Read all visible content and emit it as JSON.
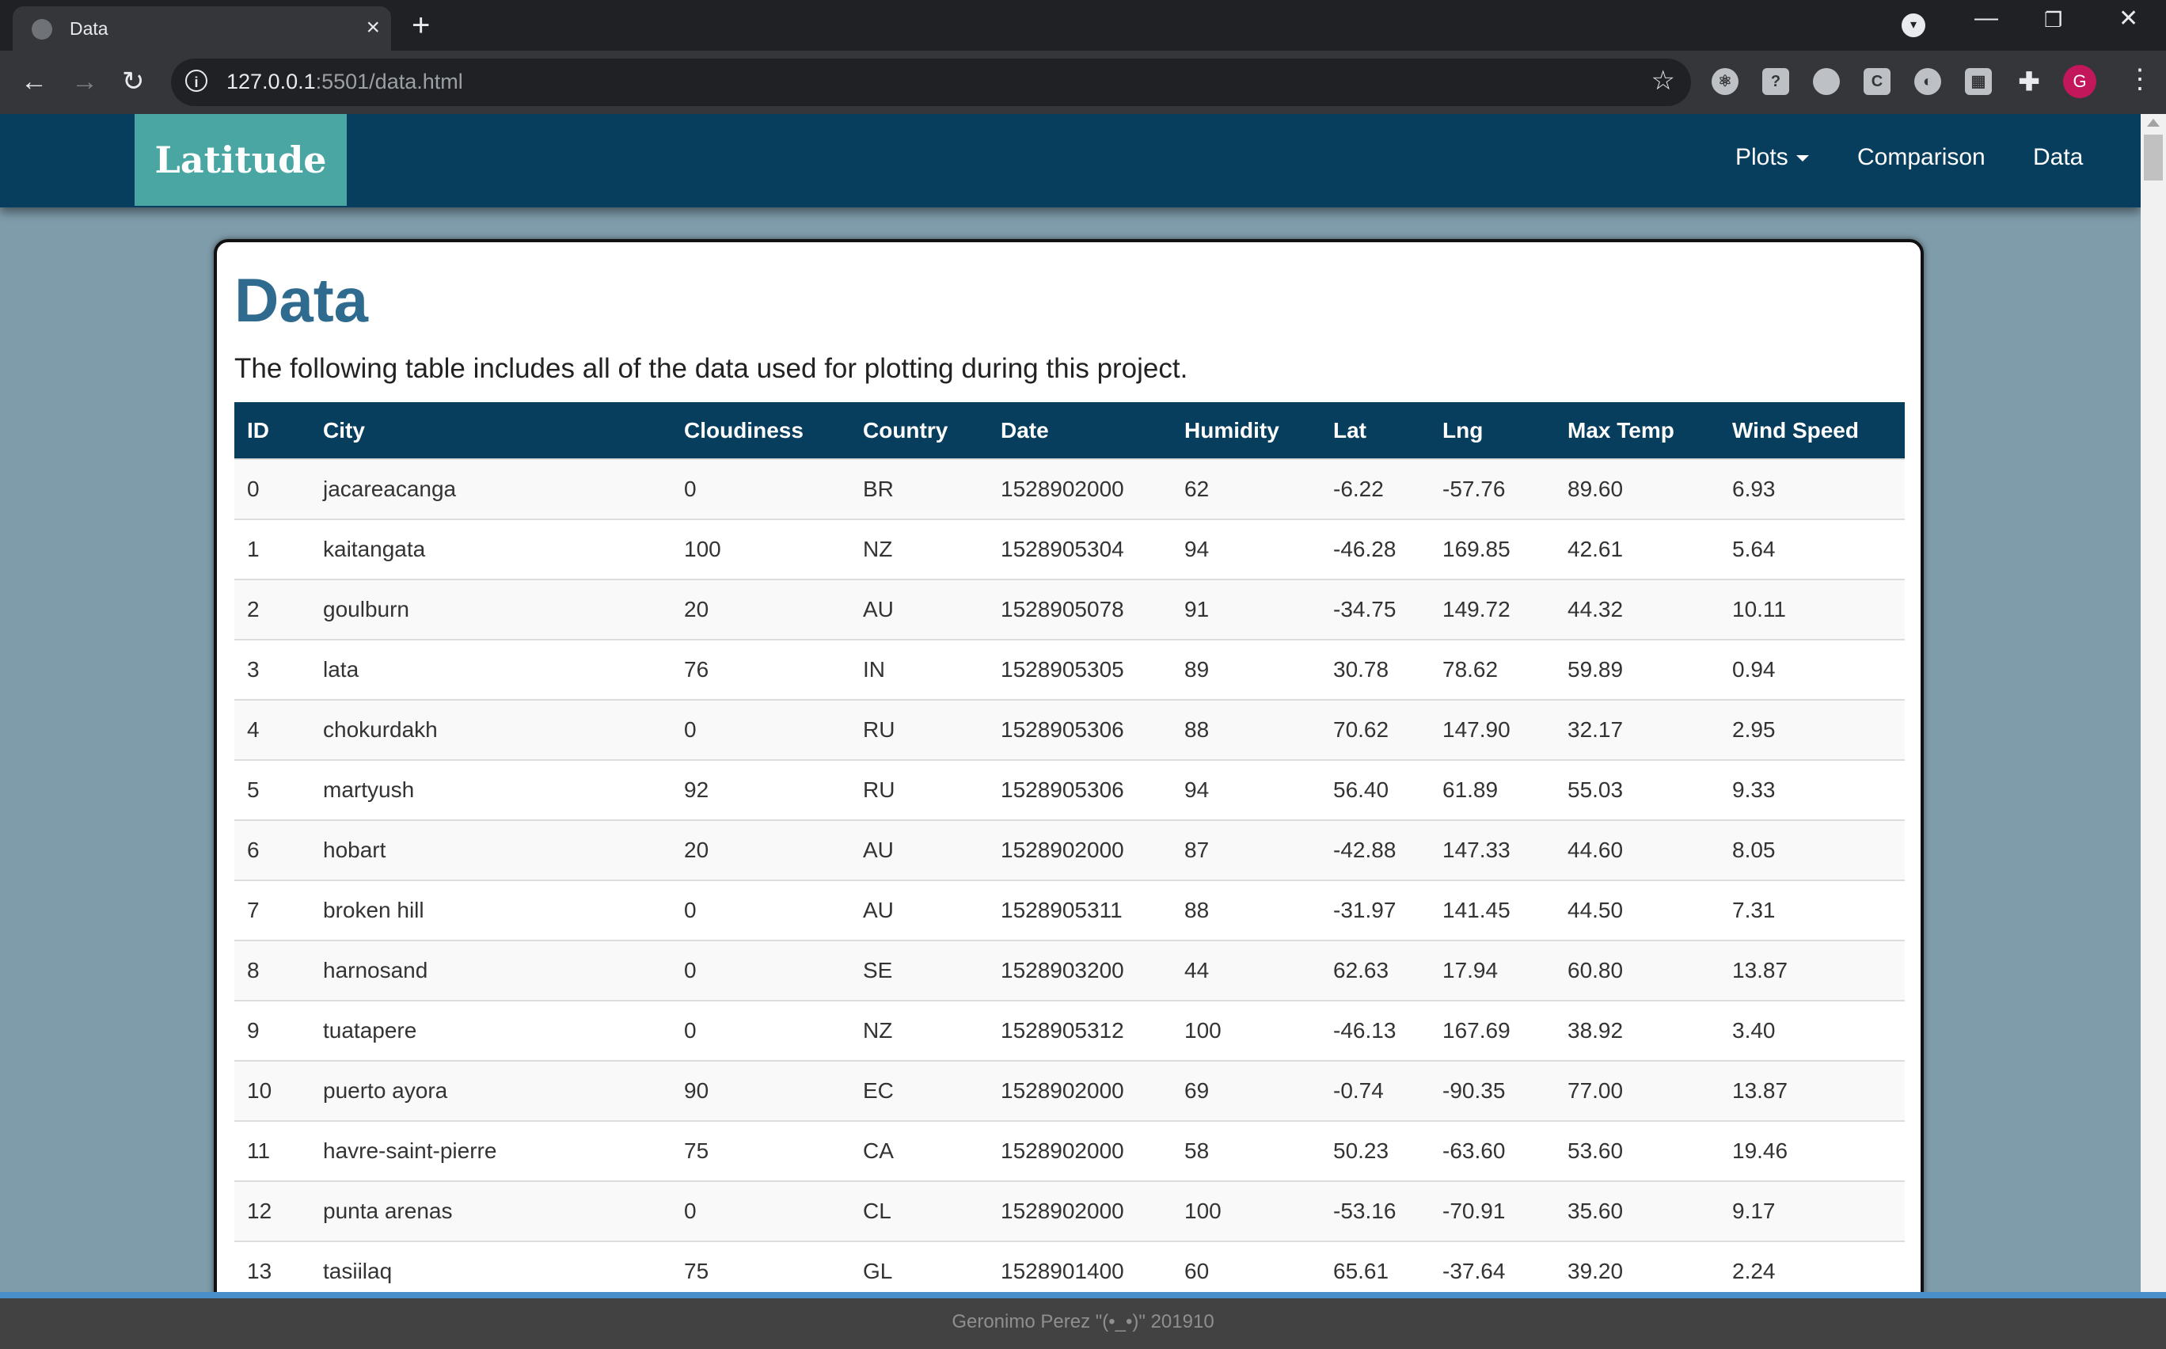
{
  "browser": {
    "tab_title": "Data",
    "url_host": "127.0.0.1",
    "url_rest": ":5501/data.html",
    "avatar_letter": "G"
  },
  "navbar": {
    "brand": "Latitude",
    "links": [
      "Plots",
      "Comparison",
      "Data"
    ]
  },
  "page": {
    "title": "Data",
    "lead": "The following table includes all of the data used for plotting during this project."
  },
  "table": {
    "headers": [
      "ID",
      "City",
      "Cloudiness",
      "Country",
      "Date",
      "Humidity",
      "Lat",
      "Lng",
      "Max Temp",
      "Wind Speed"
    ],
    "rows": [
      [
        "0",
        "jacareacanga",
        "0",
        "BR",
        "1528902000",
        "62",
        "-6.22",
        "-57.76",
        "89.60",
        "6.93"
      ],
      [
        "1",
        "kaitangata",
        "100",
        "NZ",
        "1528905304",
        "94",
        "-46.28",
        "169.85",
        "42.61",
        "5.64"
      ],
      [
        "2",
        "goulburn",
        "20",
        "AU",
        "1528905078",
        "91",
        "-34.75",
        "149.72",
        "44.32",
        "10.11"
      ],
      [
        "3",
        "lata",
        "76",
        "IN",
        "1528905305",
        "89",
        "30.78",
        "78.62",
        "59.89",
        "0.94"
      ],
      [
        "4",
        "chokurdakh",
        "0",
        "RU",
        "1528905306",
        "88",
        "70.62",
        "147.90",
        "32.17",
        "2.95"
      ],
      [
        "5",
        "martyush",
        "92",
        "RU",
        "1528905306",
        "94",
        "56.40",
        "61.89",
        "55.03",
        "9.33"
      ],
      [
        "6",
        "hobart",
        "20",
        "AU",
        "1528902000",
        "87",
        "-42.88",
        "147.33",
        "44.60",
        "8.05"
      ],
      [
        "7",
        "broken hill",
        "0",
        "AU",
        "1528905311",
        "88",
        "-31.97",
        "141.45",
        "44.50",
        "7.31"
      ],
      [
        "8",
        "harnosand",
        "0",
        "SE",
        "1528903200",
        "44",
        "62.63",
        "17.94",
        "60.80",
        "13.87"
      ],
      [
        "9",
        "tuatapere",
        "0",
        "NZ",
        "1528905312",
        "100",
        "-46.13",
        "167.69",
        "38.92",
        "3.40"
      ],
      [
        "10",
        "puerto ayora",
        "90",
        "EC",
        "1528902000",
        "69",
        "-0.74",
        "-90.35",
        "77.00",
        "13.87"
      ],
      [
        "11",
        "havre-saint-pierre",
        "75",
        "CA",
        "1528902000",
        "58",
        "50.23",
        "-63.60",
        "53.60",
        "19.46"
      ],
      [
        "12",
        "punta arenas",
        "0",
        "CL",
        "1528902000",
        "100",
        "-53.16",
        "-70.91",
        "35.60",
        "9.17"
      ],
      [
        "13",
        "tasiilaq",
        "75",
        "GL",
        "1528901400",
        "60",
        "65.61",
        "-37.64",
        "39.20",
        "2.24"
      ]
    ]
  },
  "footer": {
    "text": "Geronimo Perez \"(•_•)\" 201910"
  },
  "colors": {
    "navbar": "#073e5e",
    "brand": "#4aa6a3",
    "title": "#2f6a8f",
    "page_bg": "#7f9cab"
  }
}
